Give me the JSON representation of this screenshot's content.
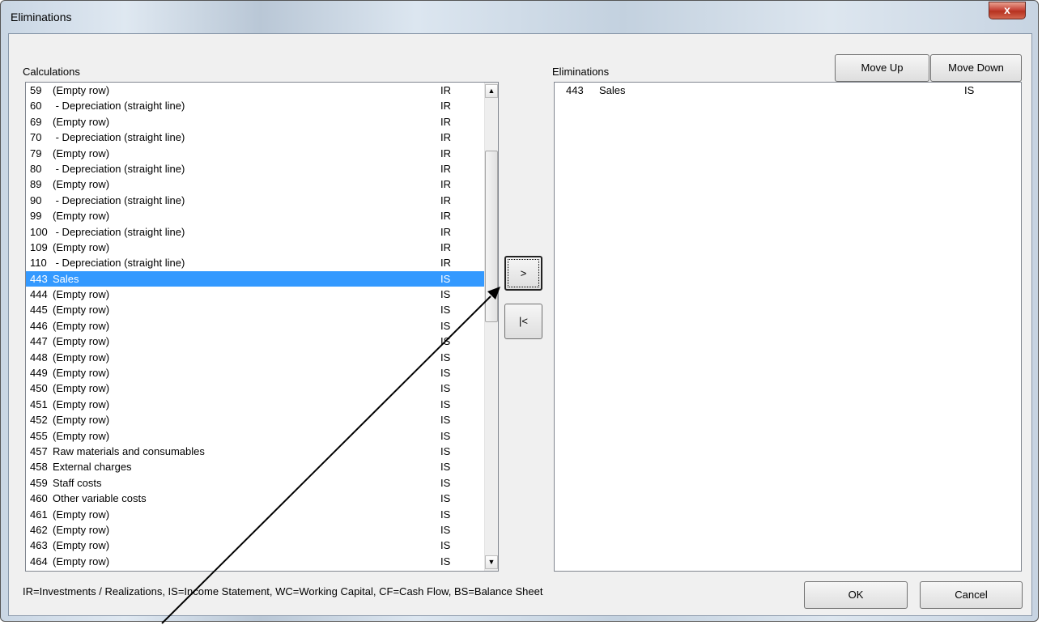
{
  "window": {
    "title": "Eliminations",
    "close_glyph": "x"
  },
  "calculations": {
    "label": "Calculations",
    "rows": [
      {
        "num": "59",
        "name": "(Empty row)",
        "code": "IR"
      },
      {
        "num": "60",
        "name": " - Depreciation (straight line)",
        "code": "IR"
      },
      {
        "num": "69",
        "name": "(Empty row)",
        "code": "IR"
      },
      {
        "num": "70",
        "name": " - Depreciation (straight line)",
        "code": "IR"
      },
      {
        "num": "79",
        "name": "(Empty row)",
        "code": "IR"
      },
      {
        "num": "80",
        "name": " - Depreciation (straight line)",
        "code": "IR"
      },
      {
        "num": "89",
        "name": "(Empty row)",
        "code": "IR"
      },
      {
        "num": "90",
        "name": " - Depreciation (straight line)",
        "code": "IR"
      },
      {
        "num": "99",
        "name": "(Empty row)",
        "code": "IR"
      },
      {
        "num": "100",
        "name": " - Depreciation (straight line)",
        "code": "IR"
      },
      {
        "num": "109",
        "name": "(Empty row)",
        "code": "IR"
      },
      {
        "num": "110",
        "name": " - Depreciation (straight line)",
        "code": "IR"
      },
      {
        "num": "443",
        "name": "Sales",
        "code": "IS",
        "selected": true
      },
      {
        "num": "444",
        "name": "(Empty row)",
        "code": "IS"
      },
      {
        "num": "445",
        "name": "(Empty row)",
        "code": "IS"
      },
      {
        "num": "446",
        "name": "(Empty row)",
        "code": "IS"
      },
      {
        "num": "447",
        "name": "(Empty row)",
        "code": "IS"
      },
      {
        "num": "448",
        "name": "(Empty row)",
        "code": "IS"
      },
      {
        "num": "449",
        "name": "(Empty row)",
        "code": "IS"
      },
      {
        "num": "450",
        "name": "(Empty row)",
        "code": "IS"
      },
      {
        "num": "451",
        "name": "(Empty row)",
        "code": "IS"
      },
      {
        "num": "452",
        "name": "(Empty row)",
        "code": "IS"
      },
      {
        "num": "455",
        "name": "(Empty row)",
        "code": "IS"
      },
      {
        "num": "457",
        "name": "Raw materials and consumables",
        "code": "IS"
      },
      {
        "num": "458",
        "name": "External charges",
        "code": "IS"
      },
      {
        "num": "459",
        "name": "Staff costs",
        "code": "IS"
      },
      {
        "num": "460",
        "name": "Other variable costs",
        "code": "IS"
      },
      {
        "num": "461",
        "name": "(Empty row)",
        "code": "IS"
      },
      {
        "num": "462",
        "name": "(Empty row)",
        "code": "IS"
      },
      {
        "num": "463",
        "name": "(Empty row)",
        "code": "IS"
      },
      {
        "num": "464",
        "name": "(Empty row)",
        "code": "IS"
      }
    ]
  },
  "eliminations": {
    "label": "Eliminations",
    "rows": [
      {
        "num": "443",
        "name": "Sales",
        "code": "IS"
      }
    ]
  },
  "buttons": {
    "move_up": "Move Up",
    "move_down": "Move Down",
    "add": ">",
    "remove": "|<",
    "ok": "OK",
    "cancel": "Cancel"
  },
  "scrollbar": {
    "up_glyph": "▲",
    "down_glyph": "▼"
  },
  "legend": "IR=Investments / Realizations, IS=Income Statement, WC=Working Capital, CF=Cash Flow, BS=Balance Sheet"
}
